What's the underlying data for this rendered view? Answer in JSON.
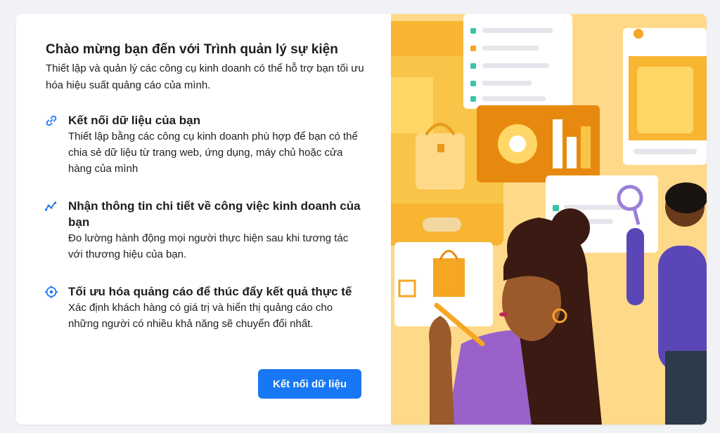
{
  "intro": {
    "title": "Chào mừng bạn đến với Trình quản lý sự kiện",
    "subtitle": "Thiết lập và quản lý các công cụ kinh doanh có thể hỗ trợ bạn tối ưu hóa hiệu suất quảng cáo của mình."
  },
  "features": [
    {
      "icon": "link-icon",
      "title": "Kết nối dữ liệu của bạn",
      "description": "Thiết lập bằng các công cụ kinh doanh phù hợp để bạn có thể chia sẻ dữ liệu từ trang web, ứng dụng, máy chủ hoặc cửa hàng của mình"
    },
    {
      "icon": "trend-line-icon",
      "title": "Nhận thông tin chi tiết về công việc kinh doanh của bạn",
      "description": "Đo lường hành động mọi người thực hiện sau khi tương tác với thương hiệu của bạn."
    },
    {
      "icon": "target-icon",
      "title": "Tối ưu hóa quảng cáo để thúc đẩy kết quả thực tế",
      "description": "Xác định khách hàng có giá trị và hiển thị quảng cáo cho những người có nhiều khả năng sẽ chuyển đổi nhất."
    }
  ],
  "primary_button": {
    "label": "Kết nối dữ liệu"
  },
  "colors": {
    "accent": "#1877f2",
    "illustration_bg": "#ffd98a",
    "illustration_orange": "#f5a623",
    "illustration_purple": "#6a4fc1"
  }
}
